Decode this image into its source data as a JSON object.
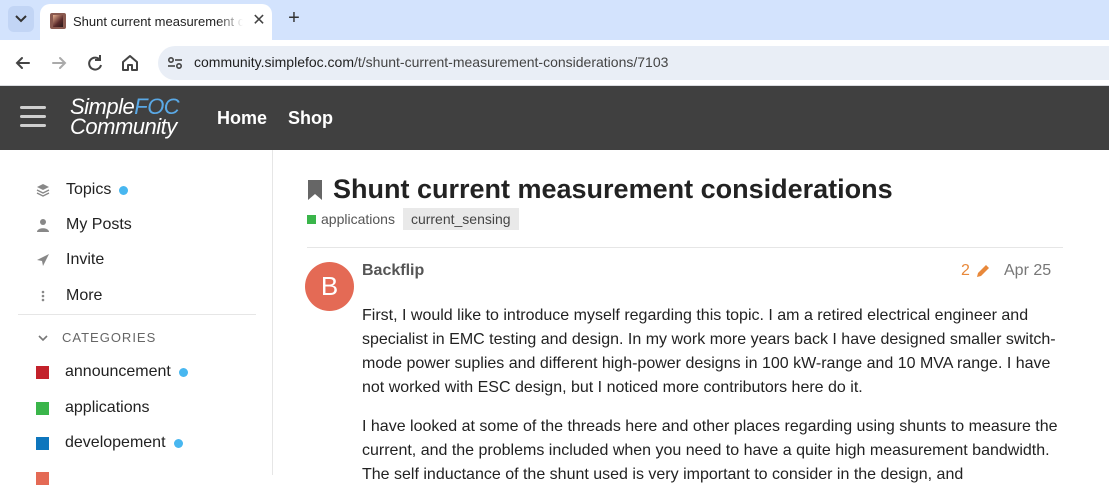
{
  "browser": {
    "tab_title": "Shunt current measurement considerations",
    "tab_close": "✕",
    "new_tab": "+",
    "url_host": "community.simplefoc.com",
    "url_path": "/t/shunt-current-measurement-considerations/7103"
  },
  "header": {
    "logo_line1": "Simple",
    "logo_line1_accent": "FOC",
    "logo_line2": "Community",
    "nav": [
      "Home",
      "Shop"
    ]
  },
  "sidebar": {
    "items": [
      {
        "label": "Topics",
        "icon": "layers-icon",
        "dot": true
      },
      {
        "label": "My Posts",
        "icon": "user-icon",
        "dot": false
      },
      {
        "label": "Invite",
        "icon": "paper-plane-icon",
        "dot": false
      },
      {
        "label": "More",
        "icon": "ellipsis-vertical-icon",
        "dot": false
      }
    ],
    "categories_heading": "CATEGORIES",
    "categories": [
      {
        "label": "announcement",
        "color": "#c3212b",
        "dot": true
      },
      {
        "label": "applications",
        "color": "#3ab54a",
        "dot": false
      },
      {
        "label": "developement",
        "color": "#0e76bd",
        "dot": true
      },
      {
        "label": "",
        "color": "#e46a55",
        "dot": false
      }
    ]
  },
  "topic": {
    "title": "Shunt current measurement considerations",
    "category": "applications",
    "category_color": "#3ab54a",
    "tag": "current_sensing"
  },
  "post": {
    "avatar_letter": "B",
    "avatar_color": "#e46a55",
    "username": "Backflip",
    "edit_count": "2",
    "date": "Apr 25",
    "paragraphs": [
      "First, I would like to introduce myself regarding this topic. I am a retired electrical engineer and specialist in EMC testing and design. In my work more years back I have designed smaller switch-mode power suplies and different high-power designs in 100 kW-range and 10 MVA range. I have not worked with ESC design, but I noticed more contributors here do it.",
      "I have looked at some of the threads here and other places regarding using shunts to measure the current, and the problems included when you need to have a quite high measurement bandwidth. The self inductance of the shunt used is very important to consider in the design, and"
    ]
  }
}
